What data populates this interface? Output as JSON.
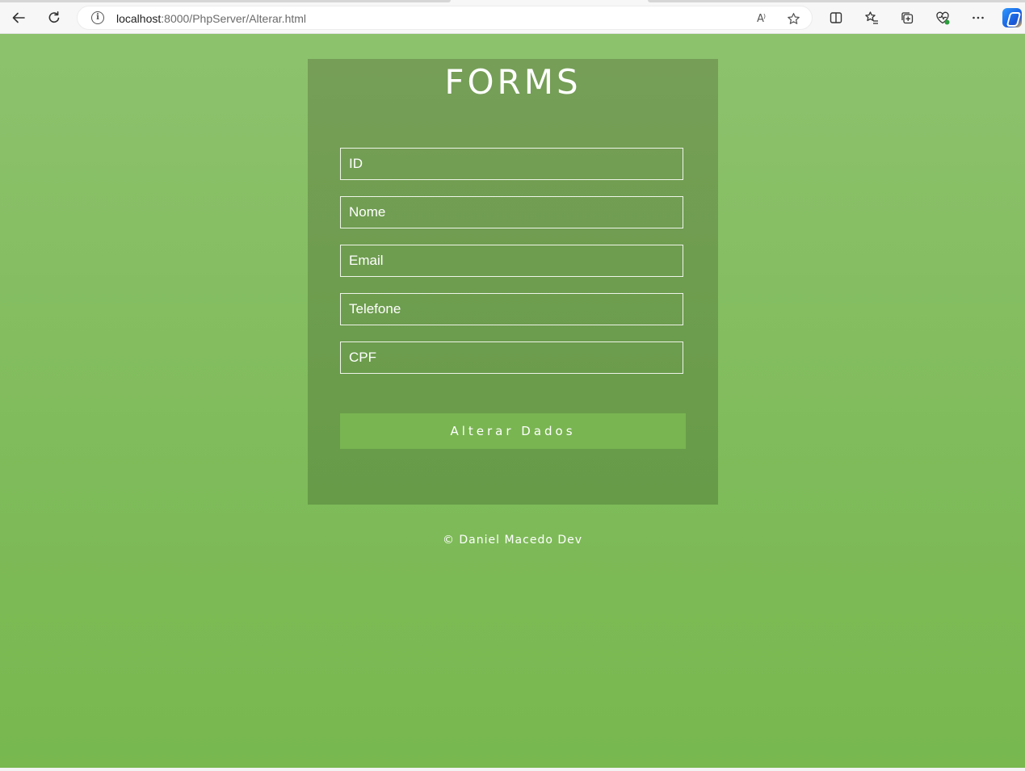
{
  "browser": {
    "url_host": "localhost",
    "url_path": ":8000/PhpServer/Alterar.html",
    "read_aloud_label": "A⁾",
    "info_glyph": "i"
  },
  "form": {
    "title": "FORMS",
    "fields": [
      {
        "placeholder": "ID"
      },
      {
        "placeholder": "Nome"
      },
      {
        "placeholder": "Email"
      },
      {
        "placeholder": "Telefone"
      },
      {
        "placeholder": "CPF"
      }
    ],
    "submit_label": "Alterar Dados"
  },
  "footer": {
    "text": "© Daniel Macedo Dev"
  },
  "colors": {
    "background_top": "#8dc26d",
    "background_bottom": "#78b84f",
    "card": "#6e9d4f",
    "button": "#79b551"
  }
}
